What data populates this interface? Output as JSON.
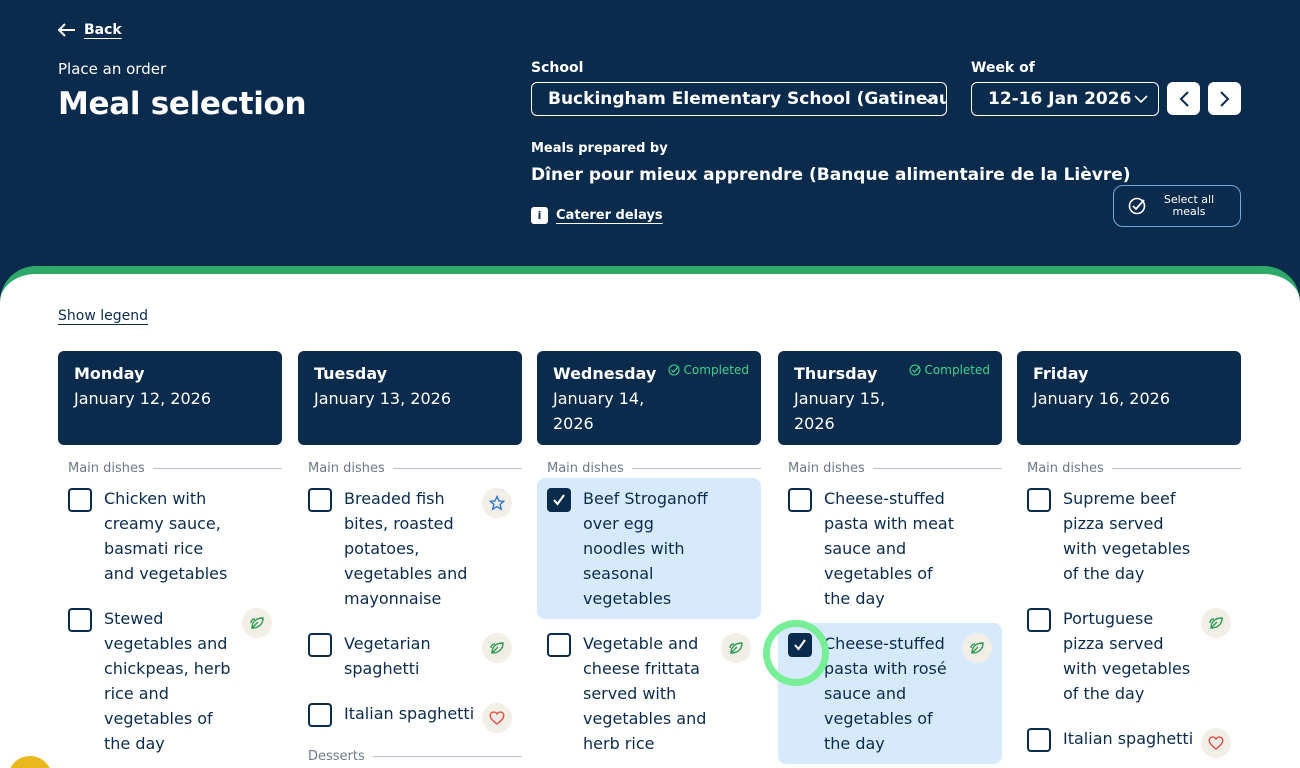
{
  "header": {
    "back_label": "Back",
    "subtitle": "Place an order",
    "title": "Meal selection",
    "school_label": "School",
    "school_value": "Buckingham Elementary School (Gatineau)",
    "week_label": "Week of",
    "week_value": "12-16 Jan 2026",
    "prepared_label": "Meals prepared by",
    "prepared_value": "Dîner pour mieux apprendre (Banque alimentaire de la Lièvre)",
    "delays_label": "Caterer delays",
    "select_all_label": "Select all meals"
  },
  "legend_label": "Show legend",
  "days": [
    {
      "name": "Monday",
      "date": "January 12, 2026",
      "completed": "",
      "section": "Main dishes",
      "items": [
        {
          "name": "Chicken with creamy sauce, basmati rice and vegetables",
          "checked": false,
          "badge": ""
        },
        {
          "name": "Stewed vegetables and chickpeas, herb rice and vegetables of the day",
          "checked": false,
          "badge": "leaf-icon"
        }
      ]
    },
    {
      "name": "Tuesday",
      "date": "January 13, 2026",
      "completed": "",
      "section": "Main dishes",
      "items": [
        {
          "name": "Breaded fish bites, roasted potatoes, vegetables and mayonnaise",
          "checked": false,
          "badge": "star-icon"
        },
        {
          "name": "Vegetarian spaghetti",
          "checked": false,
          "badge": "leaf-icon"
        },
        {
          "name": "Italian spaghetti",
          "checked": false,
          "badge": "heart-icon"
        }
      ],
      "next_section": "Desserts"
    },
    {
      "name": "Wednesday",
      "date": "January 14, 2026",
      "completed": "Completed",
      "section": "Main dishes",
      "items": [
        {
          "name": "Beef Stroganoff over egg noodles with seasonal vegetables",
          "checked": true,
          "badge": ""
        },
        {
          "name": "Vegetable and cheese frittata served with vegetables and herb rice",
          "checked": false,
          "badge": "leaf-icon"
        }
      ]
    },
    {
      "name": "Thursday",
      "date": "January 15, 2026",
      "completed": "Completed",
      "section": "Main dishes",
      "items": [
        {
          "name": "Cheese-stuffed pasta with meat sauce and vegetables of the day",
          "checked": false,
          "badge": ""
        },
        {
          "name": "Cheese-stuffed pasta with rosé sauce and vegetables of the day",
          "checked": true,
          "badge": "leaf-icon"
        }
      ]
    },
    {
      "name": "Friday",
      "date": "January 16, 2026",
      "completed": "",
      "section": "Main dishes",
      "items": [
        {
          "name": "Supreme beef pizza served with vegetables of the day",
          "checked": false,
          "badge": ""
        },
        {
          "name": "Portuguese pizza served with vegetables of the day",
          "checked": false,
          "badge": "leaf-icon"
        },
        {
          "name": "Italian spaghetti",
          "checked": false,
          "badge": "heart-icon"
        }
      ]
    }
  ],
  "colors": {
    "navy": "#0b2b4c",
    "accent_green": "#2daa6a",
    "completed_green": "#3fd18c",
    "selected_bg": "#d6eafc",
    "focus_ring": "#78ef96"
  }
}
